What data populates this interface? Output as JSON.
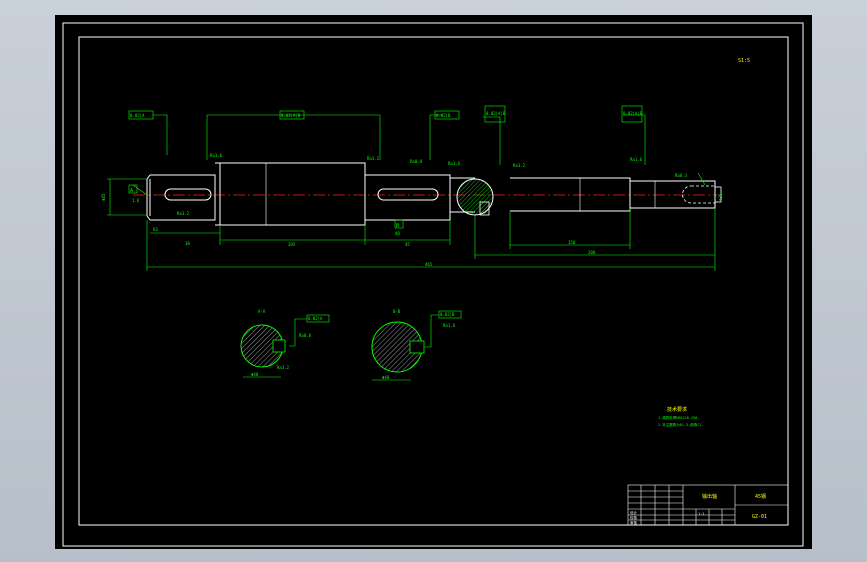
{
  "scale_note": "S1:5",
  "section_labels": [
    "A-A",
    "B-B"
  ],
  "callouts": {
    "left_key": "0.02|A",
    "mid_top": "0.02|A|B",
    "mid_right": "0.02|B",
    "hatch": "0.02|A|B",
    "right": "0.02|A|B",
    "sec1": "0.02|A",
    "sec2": "0.02|B"
  },
  "surface_marks": [
    "Ra1.6",
    "Ra3.2",
    "Ra0.8",
    "Ra1.6",
    "Ra3.2",
    "Ra1.6",
    "Ra3.2",
    "Ra6.3"
  ],
  "dimensions": {
    "left_dia": "Φ45",
    "left_small": "1.6",
    "key_len_left": "63",
    "seg_a": "38",
    "seg_b": "45",
    "seg_total_mid": "205",
    "key_len_mid": "40",
    "overall": "465",
    "right_len": "150",
    "right_span": "200",
    "right_dia": "Φ35",
    "sec1_dim": "Φ40",
    "sec2_dim": "Φ48"
  },
  "datum_labels": [
    "A",
    "B"
  ],
  "tech_req": {
    "title": "技术要求",
    "lines": [
      "1.调质处理HBS220-250.",
      "2.未注圆角为R1.5,倒角C1."
    ]
  },
  "title_block": {
    "part_name": "输出轴",
    "material": "45钢",
    "drawing_no": "GZ-01",
    "scale": "1:1",
    "rows": [
      "设计",
      "校核",
      "审核"
    ]
  }
}
